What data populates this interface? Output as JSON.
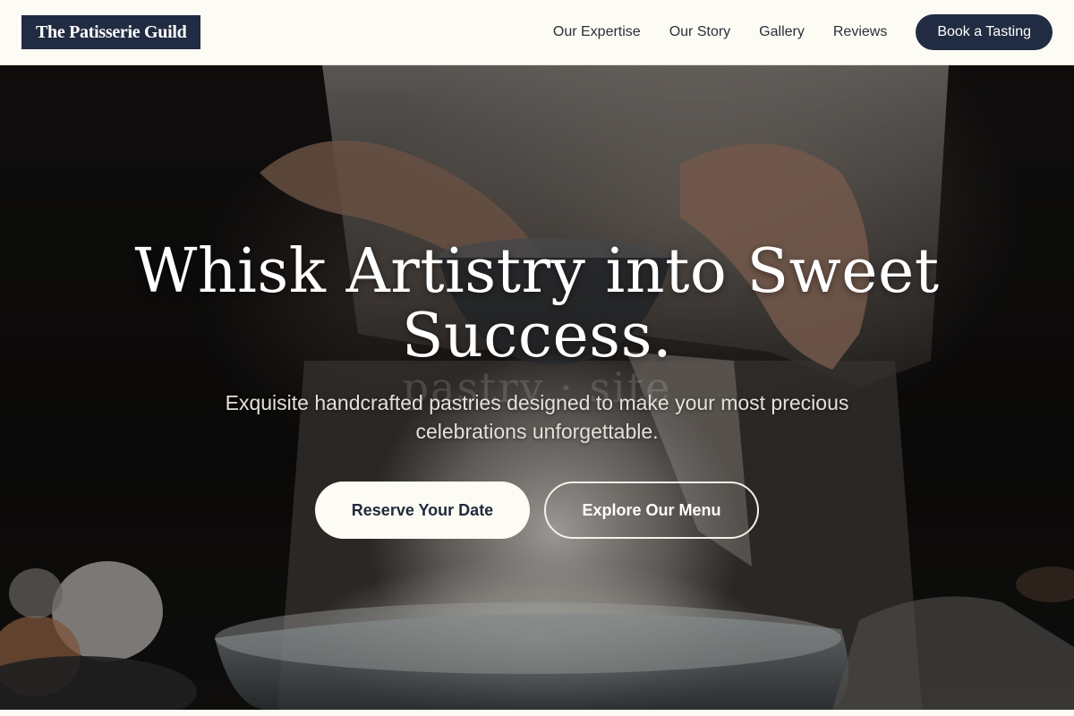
{
  "header": {
    "logo": "The Patisserie Guild",
    "nav": [
      {
        "label": "Our Expertise"
      },
      {
        "label": "Our Story"
      },
      {
        "label": "Gallery"
      },
      {
        "label": "Reviews"
      }
    ],
    "cta_label": "Book a Tasting"
  },
  "hero": {
    "headline": "Whisk Artistry into Sweet Success.",
    "subhead": "Exquisite handcrafted pastries designed to make your most precious celebrations unforgettable.",
    "primary_button": "Reserve Your Date",
    "secondary_button": "Explore Our Menu",
    "background_image": "baker-sifting-flour-photo"
  },
  "colors": {
    "header_bg": "#fdfcf4",
    "brand_navy": "#212b41",
    "hero_text": "#ffffff"
  }
}
